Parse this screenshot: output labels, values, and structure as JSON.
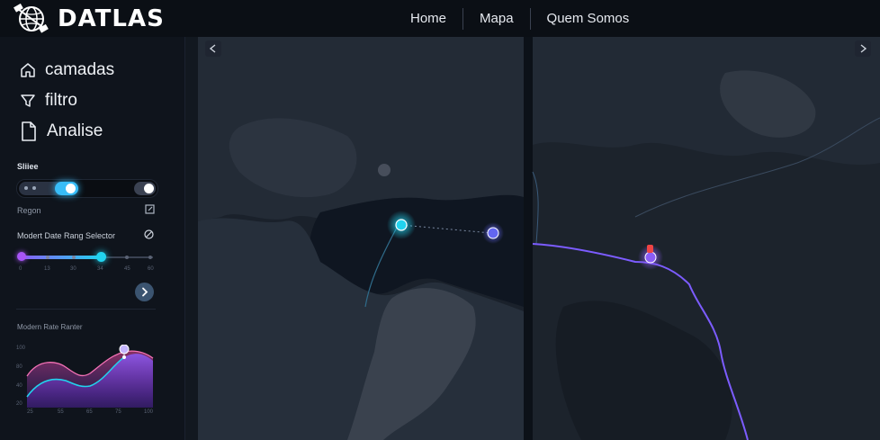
{
  "brand": {
    "name": "DATLAS"
  },
  "nav": {
    "items": [
      "Home",
      "Mapa",
      "Quem Somos"
    ]
  },
  "sidebar": {
    "menu": [
      {
        "label": "camadas",
        "icon": "home-icon"
      },
      {
        "label": "filtro",
        "icon": "filter-icon"
      },
      {
        "label": "Analise",
        "icon": "document-icon"
      }
    ],
    "slider_section": {
      "title": "Sliiee"
    },
    "region": {
      "label": "Regon"
    },
    "date_range": {
      "title": "Modert Date Rang Selector",
      "ticks": [
        "0",
        "13",
        "30",
        "34",
        "45",
        "60"
      ],
      "selected_start": "0",
      "selected_end": "34"
    },
    "rate_chart": {
      "title": "Modern Rate Ranter",
      "y_ticks": [
        "100",
        "80",
        "40",
        "20"
      ],
      "x_ticks": [
        "25",
        "55",
        "65",
        "75",
        "100"
      ]
    }
  },
  "map": {
    "nav_left_icon": "chevron-left-icon",
    "nav_right_icon": "chevron-right-icon"
  },
  "colors": {
    "accent_cyan": "#22d3ee",
    "accent_purple": "#8b5cf6",
    "accent_blue": "#6366f1",
    "marker_red": "#ef4444"
  }
}
